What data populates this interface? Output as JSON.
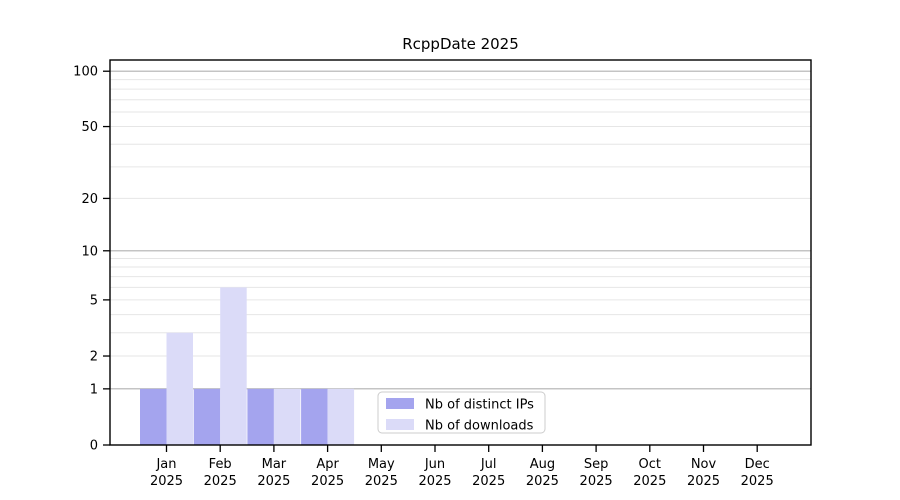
{
  "chart_data": {
    "type": "bar",
    "title": "RcppDate 2025",
    "x_categories": [
      "Jan",
      "Feb",
      "Mar",
      "Apr",
      "May",
      "Jun",
      "Jul",
      "Aug",
      "Sep",
      "Oct",
      "Nov",
      "Dec"
    ],
    "x_year": "2025",
    "series": [
      {
        "name": "Nb of distinct IPs",
        "color": "#a4a4ee",
        "values": [
          1,
          1,
          1,
          1,
          0,
          0,
          0,
          0,
          0,
          0,
          0,
          0
        ]
      },
      {
        "name": "Nb of downloads",
        "color": "#dbdbf8",
        "values": [
          3,
          6,
          1,
          1,
          0,
          0,
          0,
          0,
          0,
          0,
          0,
          0
        ]
      }
    ],
    "y_scale": "log1p",
    "y_tick_labels": [
      0,
      1,
      2,
      5,
      10,
      20,
      50,
      100
    ],
    "y_major_gridlines": [
      1,
      10,
      100
    ],
    "y_minor_gridlines": [
      2,
      3,
      4,
      5,
      6,
      7,
      8,
      9,
      20,
      30,
      40,
      50,
      60,
      70,
      80,
      90
    ],
    "ylim": [
      0,
      115
    ],
    "legend": {
      "position": "lower-center",
      "entries": [
        "Nb of distinct IPs",
        "Nb of downloads"
      ]
    },
    "colors": {
      "bar_distinct_ips": "#a4a4ee",
      "bar_downloads": "#dbdbf8",
      "grid_major": "#b0b0b0",
      "grid_minor": "#e6e6e6",
      "axis": "#000000",
      "text": "#000000",
      "legend_border": "#cccccc",
      "background": "#ffffff"
    }
  }
}
